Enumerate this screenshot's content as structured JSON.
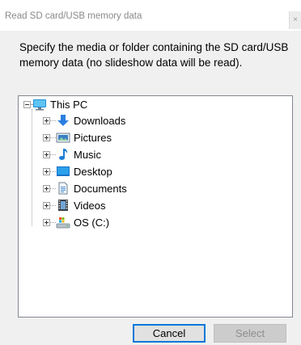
{
  "window": {
    "title": "Read SD card/USB memory data",
    "close_glyph": "×"
  },
  "dialog": {
    "description": "Specify the media or folder containing the SD card/USB memory data (no slideshow data will be read)."
  },
  "tree": {
    "root": {
      "label": "This PC",
      "icon": "this-pc-icon",
      "expanded": true
    },
    "children": [
      {
        "label": "Downloads",
        "icon": "downloads-icon"
      },
      {
        "label": "Pictures",
        "icon": "pictures-icon"
      },
      {
        "label": "Music",
        "icon": "music-icon"
      },
      {
        "label": "Desktop",
        "icon": "desktop-icon"
      },
      {
        "label": "Documents",
        "icon": "documents-icon"
      },
      {
        "label": "Videos",
        "icon": "videos-icon"
      },
      {
        "label": "OS (C:)",
        "icon": "drive-icon"
      }
    ]
  },
  "buttons": {
    "cancel_label": "Cancel",
    "select_label": "Select",
    "select_enabled": false
  },
  "colors": {
    "accent": "#0078d7",
    "dialog_bg": "#f0f0f0",
    "disabled_text": "#8d8d8d"
  }
}
